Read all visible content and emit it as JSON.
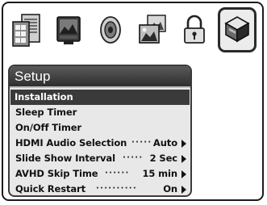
{
  "icon_bar": {
    "icons": [
      {
        "name": "language-icon"
      },
      {
        "name": "display-icon"
      },
      {
        "name": "audio-icon"
      },
      {
        "name": "photo-icon"
      },
      {
        "name": "lock-icon"
      },
      {
        "name": "setup-icon",
        "active": true
      }
    ]
  },
  "panel": {
    "title": "Setup",
    "items": [
      {
        "label": "Installation",
        "selected": true
      },
      {
        "label": "Sleep Timer"
      },
      {
        "label": "On/Off Timer"
      },
      {
        "label": "HDMI Audio Selection",
        "value": "Auto",
        "has_arrow": true
      },
      {
        "label": "Slide Show Interval",
        "value": "2 Sec",
        "has_arrow": true
      },
      {
        "label": "AVHD Skip Time",
        "value": "15 min",
        "has_arrow": true
      },
      {
        "label": "Quick Restart",
        "value": "On",
        "has_arrow": true
      }
    ]
  },
  "colors": {
    "title_bar": "#3a3a3a",
    "selected_row": "#3a3a3a",
    "panel_bg": "#e8e8e8"
  }
}
